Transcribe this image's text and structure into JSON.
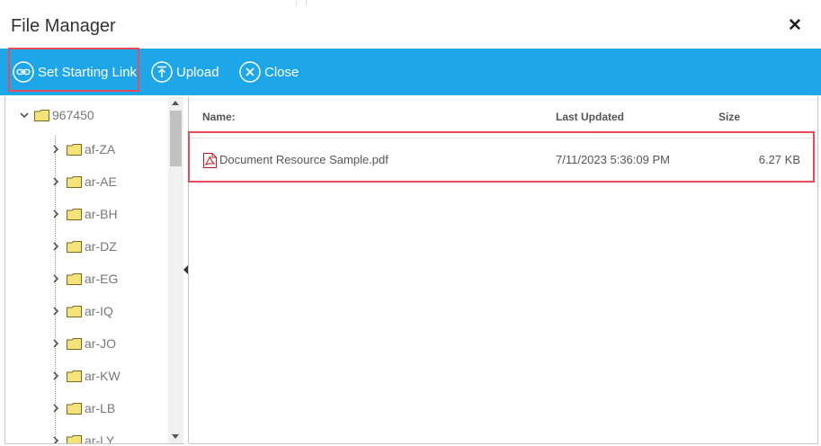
{
  "window": {
    "title": "File Manager",
    "close_glyph": "✕"
  },
  "toolbar": {
    "set_starting_link_label": "Set Starting Link",
    "upload_label": "Upload",
    "close_label": "Close"
  },
  "tree": {
    "root": {
      "label": "967450"
    },
    "items": [
      {
        "label": "af-ZA"
      },
      {
        "label": "ar-AE"
      },
      {
        "label": "ar-BH"
      },
      {
        "label": "ar-DZ"
      },
      {
        "label": "ar-EG"
      },
      {
        "label": "ar-IQ"
      },
      {
        "label": "ar-JO"
      },
      {
        "label": "ar-KW"
      },
      {
        "label": "ar-LB"
      },
      {
        "label": "ar-LY"
      }
    ]
  },
  "files": {
    "columns": {
      "name": "Name:",
      "last_updated": "Last Updated",
      "size": "Size"
    },
    "rows": [
      {
        "name": "Document Resource Sample.pdf",
        "last_updated": "7/11/2023 5:36:09 PM",
        "size": "6.27 KB",
        "icon": "pdf-file-icon"
      }
    ]
  },
  "colors": {
    "toolbar": "#1ea7e8",
    "highlight": "#e84a5a",
    "folder": "#f4e27a"
  }
}
